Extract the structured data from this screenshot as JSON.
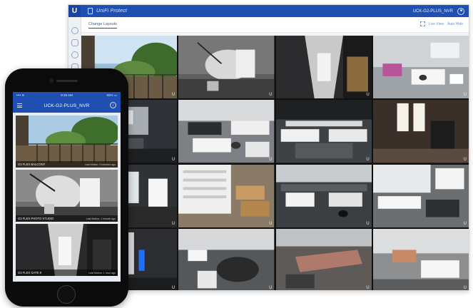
{
  "desktop": {
    "brand_letter": "U",
    "app_title": "UniFi Protect",
    "nvr_name": "UCK-G2-PLUS_NVR",
    "change_layouts_label": "Change Layouts",
    "link_one": "Live View",
    "link_two": "Auto Hide",
    "camera_mark": "U"
  },
  "phone": {
    "status_left": "•••• ≋",
    "status_time": "9:16 AM",
    "status_right": "82% ▭",
    "title": "UCK-G2-PLUS_NVR",
    "info_symbol": "i",
    "feeds": [
      {
        "name": "G3 FLEX BALCONY",
        "meta": "Last Motion: 3 minutes ago"
      },
      {
        "name": "G3 FLEX PHOTO STUDIO",
        "meta": "Last Motion: 1 minute ago"
      },
      {
        "name": "G3 FLEX GATE 8",
        "meta": "Last Motion: 1 hour ago"
      }
    ]
  }
}
